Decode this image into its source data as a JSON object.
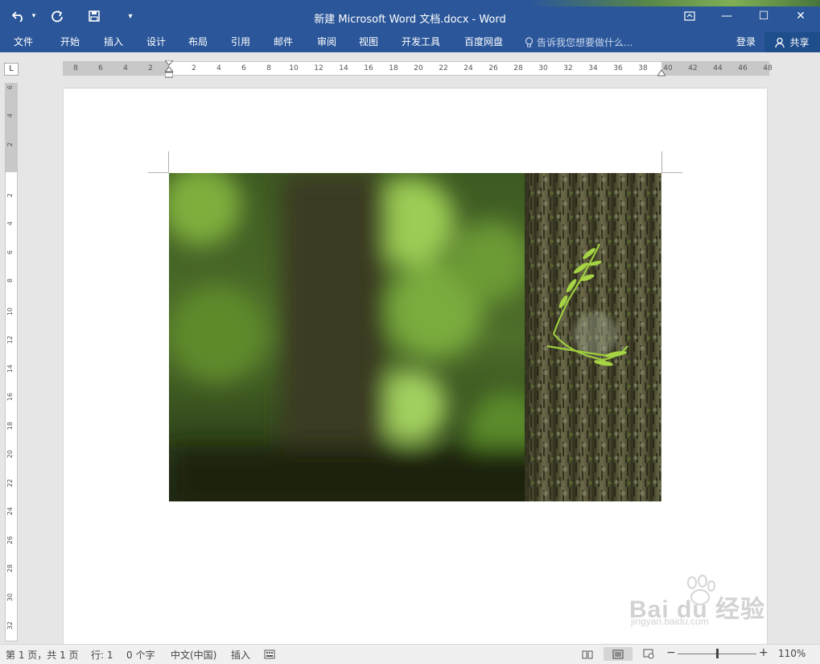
{
  "window": {
    "title": "新建 Microsoft Word 文档.docx - Word",
    "minimize_glyph": "—",
    "maximize_glyph": "☐",
    "close_glyph": "✕"
  },
  "quick_access": {
    "undo_icon": "undo-icon",
    "redo_icon": "redo-icon",
    "save_icon": "save-icon",
    "customize_icon": "customize-icon"
  },
  "ribbon": {
    "tabs": [
      "文件",
      "开始",
      "插入",
      "设计",
      "布局",
      "引用",
      "邮件",
      "审阅",
      "视图",
      "开发工具",
      "百度网盘"
    ],
    "tell_me": "告诉我您想要做什么...",
    "login": "登录",
    "share": "共享"
  },
  "ruler": {
    "horizontal": [
      "8",
      "6",
      "4",
      "2",
      "2",
      "4",
      "6",
      "8",
      "10",
      "12",
      "14",
      "16",
      "18",
      "20",
      "22",
      "24",
      "26",
      "28",
      "30",
      "32",
      "34",
      "36",
      "38",
      "40",
      "42",
      "44",
      "46",
      "48"
    ],
    "vertical": [
      "6",
      "4",
      "2",
      "2",
      "4",
      "6",
      "8",
      "10",
      "12",
      "14",
      "16",
      "18",
      "20",
      "22",
      "24",
      "26",
      "28",
      "30",
      "32"
    ],
    "tab_selector": "L"
  },
  "status": {
    "page": "第 1 页，共 1 页",
    "line": "行: 1",
    "words": "0 个字",
    "language": "中文(中国)",
    "mode": "插入",
    "zoom": "110%",
    "zoom_minus": "−",
    "zoom_plus": "+"
  },
  "watermark": {
    "brand": "Bai du 经验",
    "url": "jingyan.baidu.com"
  },
  "colors": {
    "accent": "#2b579a",
    "statusbar": "#f0f0f0",
    "canvas": "#e6e6e6"
  }
}
